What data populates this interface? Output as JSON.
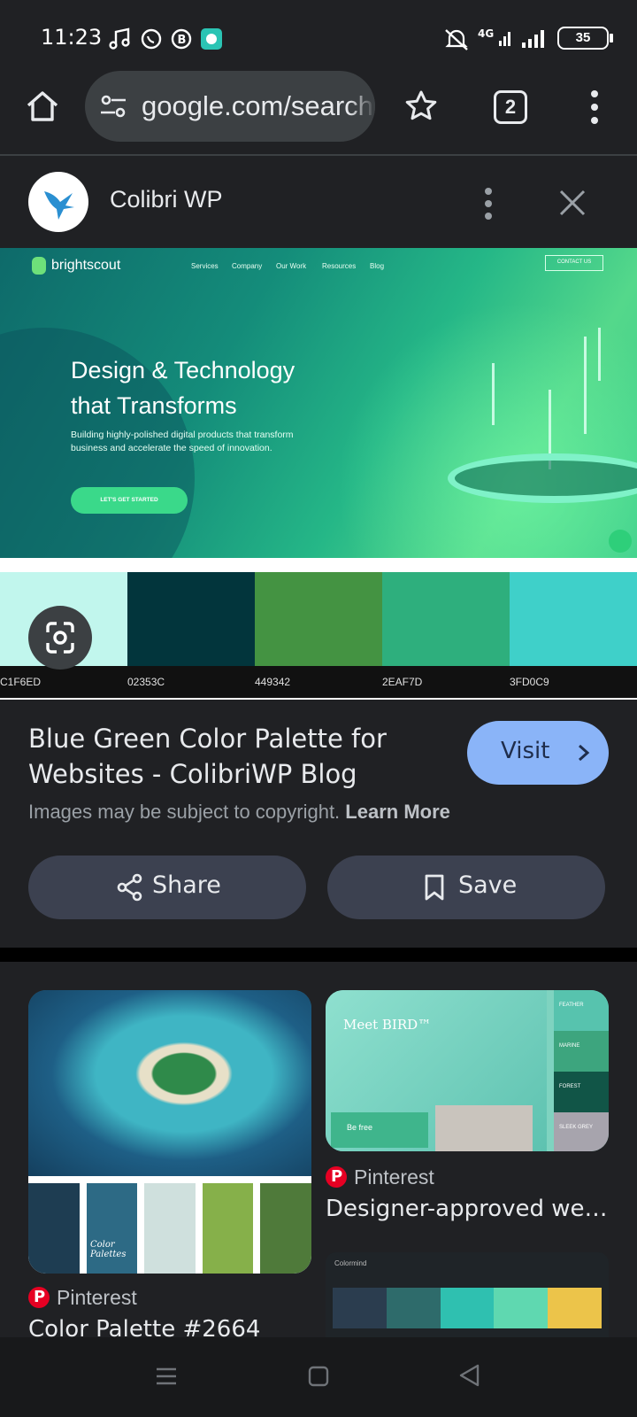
{
  "status_bar": {
    "time": "11:23",
    "network": "4G",
    "battery": "35",
    "icons": [
      "music-note-icon",
      "whatsapp-icon",
      "b-app-icon",
      "chat-app-icon",
      "mute-icon",
      "signal-icon",
      "wifi-bars-icon",
      "battery-icon"
    ]
  },
  "browser": {
    "url": "google.com/search",
    "tab_count": "2"
  },
  "source": {
    "name": "Colibri WP"
  },
  "preview": {
    "brand": "brightscout",
    "nav": [
      "Services",
      "Company",
      "Our Work",
      "Resources",
      "Blog"
    ],
    "contact": "CONTACT US",
    "headline_1": "Design & Technology",
    "headline_2": "that Transforms",
    "subtext": "Building highly-polished digital products that transform business and accelerate the speed of innovation.",
    "cta": "LET'S GET STARTED",
    "swatches": [
      {
        "code": "C1F6ED",
        "color": "#c1f6ed"
      },
      {
        "code": "02353C",
        "color": "#02353c"
      },
      {
        "code": "449342",
        "color": "#449342"
      },
      {
        "code": "2EAF7D",
        "color": "#2eaf7d"
      },
      {
        "code": "3FD0C9",
        "color": "#3fd0c9"
      }
    ]
  },
  "result": {
    "title": "Blue Green Color Palette for Websites - ColibriWP Blog",
    "visit_label": "Visit",
    "copyright_text": "Images may be subject to copyright.",
    "learn_more": "Learn More",
    "share_label": "Share",
    "save_label": "Save"
  },
  "related": [
    {
      "source": "Pinterest",
      "title": "Color Palette #2664",
      "swatches": [
        "#1e3d52",
        "#2d6a85",
        "#cfe0dd",
        "#86b04a",
        "#4f7a3a"
      ],
      "caption": "Color Palettes"
    },
    {
      "source": "Pinterest",
      "title": "Designer-approved we…",
      "headline": "Meet BIRD™",
      "subhead": "Be free",
      "swatch_labels": [
        "FEATHER",
        "MARINE",
        "FOREST",
        "SLEEK GREY"
      ]
    },
    {
      "brand": "Colormind",
      "swatches": [
        "#2b3d4f",
        "#2e6b6b",
        "#2fc0b0",
        "#5fd8b0",
        "#ecc44a"
      ]
    }
  ],
  "colors": {
    "background": "#202124",
    "accent": "#8ab4f8",
    "pill": "#3c4150"
  }
}
